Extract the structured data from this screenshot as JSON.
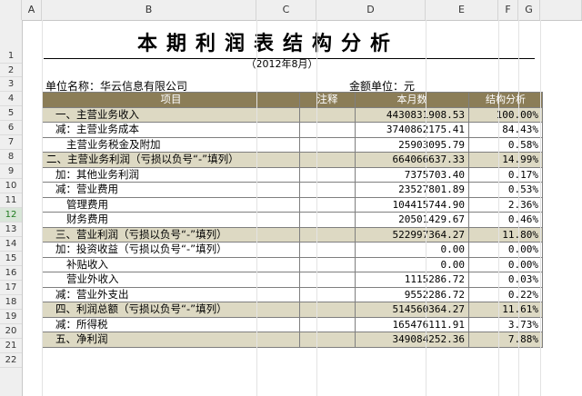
{
  "columns": [
    "A",
    "B",
    "C",
    "D",
    "E",
    "F",
    "G"
  ],
  "rows": [
    "1",
    "2",
    "3",
    "4",
    "5",
    "6",
    "7",
    "8",
    "9",
    "10",
    "11",
    "12",
    "13",
    "14",
    "15",
    "16",
    "17",
    "18",
    "19",
    "20",
    "21",
    "22"
  ],
  "selected_row": "12",
  "report": {
    "title": "本期利润表结构分析",
    "date": "（2012年8月）",
    "unit_label": "单位名称：华云信息有限公司",
    "currency_label": "金额单位：元",
    "headers": [
      "项目",
      "注释",
      "本月数",
      "结构分析"
    ],
    "lines": [
      {
        "item": "一、主营业务收入",
        "note": "",
        "amount": "4430831908.53",
        "pct": "100.00%",
        "major": true,
        "indent": 1
      },
      {
        "item": "减：主营业务成本",
        "note": "",
        "amount": "3740862175.41",
        "pct": "84.43%",
        "major": false,
        "indent": 1
      },
      {
        "item": "主营业务税金及附加",
        "note": "",
        "amount": "25903095.79",
        "pct": "0.58%",
        "major": false,
        "indent": 2
      },
      {
        "item": "二、主营业务利润（亏损以负号“-”填列）",
        "note": "",
        "amount": "664066637.33",
        "pct": "14.99%",
        "major": true,
        "indent": 0
      },
      {
        "item": "加：其他业务利润",
        "note": "",
        "amount": "7375703.40",
        "pct": "0.17%",
        "major": false,
        "indent": 1
      },
      {
        "item": "减：营业费用",
        "note": "",
        "amount": "23527801.89",
        "pct": "0.53%",
        "major": false,
        "indent": 1
      },
      {
        "item": "管理费用",
        "note": "",
        "amount": "104415744.90",
        "pct": "2.36%",
        "major": false,
        "indent": 2
      },
      {
        "item": "财务费用",
        "note": "",
        "amount": "20501429.67",
        "pct": "0.46%",
        "major": false,
        "indent": 2
      },
      {
        "item": "三、营业利润（亏损以负号“-”填列）",
        "note": "",
        "amount": "522997364.27",
        "pct": "11.80%",
        "major": true,
        "indent": 1
      },
      {
        "item": "加：投资收益（亏损以负号“-”填列）",
        "note": "",
        "amount": "0.00",
        "pct": "0.00%",
        "major": false,
        "indent": 1
      },
      {
        "item": "补贴收入",
        "note": "",
        "amount": "0.00",
        "pct": "0.00%",
        "major": false,
        "indent": 2
      },
      {
        "item": "营业外收入",
        "note": "",
        "amount": "1115286.72",
        "pct": "0.03%",
        "major": false,
        "indent": 2
      },
      {
        "item": "减：营业外支出",
        "note": "",
        "amount": "9552286.72",
        "pct": "0.22%",
        "major": false,
        "indent": 1
      },
      {
        "item": "四、利润总额（亏损以负号“-”填列）",
        "note": "",
        "amount": "514560364.27",
        "pct": "11.61%",
        "major": true,
        "indent": 1
      },
      {
        "item": "减：所得税",
        "note": "",
        "amount": "165476111.91",
        "pct": "3.73%",
        "major": false,
        "indent": 1
      },
      {
        "item": "五、净利润",
        "note": "",
        "amount": "349084252.36",
        "pct": "7.88%",
        "major": true,
        "indent": 1
      }
    ]
  },
  "colors": {
    "header_bg": "#8b7d57",
    "major_bg": "#ddd9c3"
  }
}
